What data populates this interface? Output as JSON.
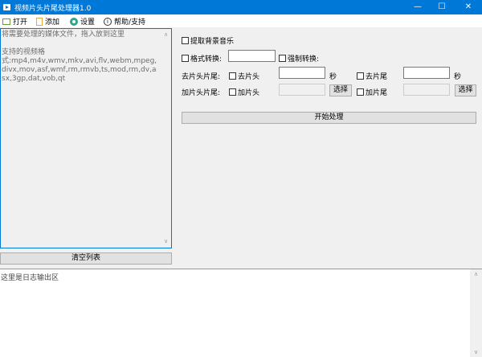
{
  "window": {
    "title": "视频片头片尾处理器1.0"
  },
  "menu": [
    {
      "label": "打开",
      "icon": "folder-icon"
    },
    {
      "label": "添加",
      "icon": "add-file-icon"
    },
    {
      "label": "设置",
      "icon": "gear-icon"
    },
    {
      "label": "帮助/支持",
      "icon": "info-icon"
    }
  ],
  "list": {
    "hint": "将需要处理的媒体文件，拖入放到这里",
    "formats_title": "支持的视频格",
    "formats": "式:mp4,m4v,wmv,mkv,avi,flv,webm,mpeg,divx,mov,asf,wmf,rm,rmvb,ts,mod,rm,dv,asx,3gp,dat,vob,qt",
    "clear_button": "清空列表"
  },
  "options": {
    "extract_bgm": "提取背景音乐",
    "format_convert": "格式转换:",
    "force_convert": "强制转换:",
    "remove_label": "去片头片尾:",
    "remove_head": "去片头",
    "remove_tail": "去片尾",
    "seconds": "秒",
    "add_label": "加片头片尾:",
    "add_head": "加片头",
    "add_tail": "加片尾",
    "choose": "选择",
    "start_button": "开始处理"
  },
  "log": {
    "placeholder": "这里是日志输出区"
  }
}
